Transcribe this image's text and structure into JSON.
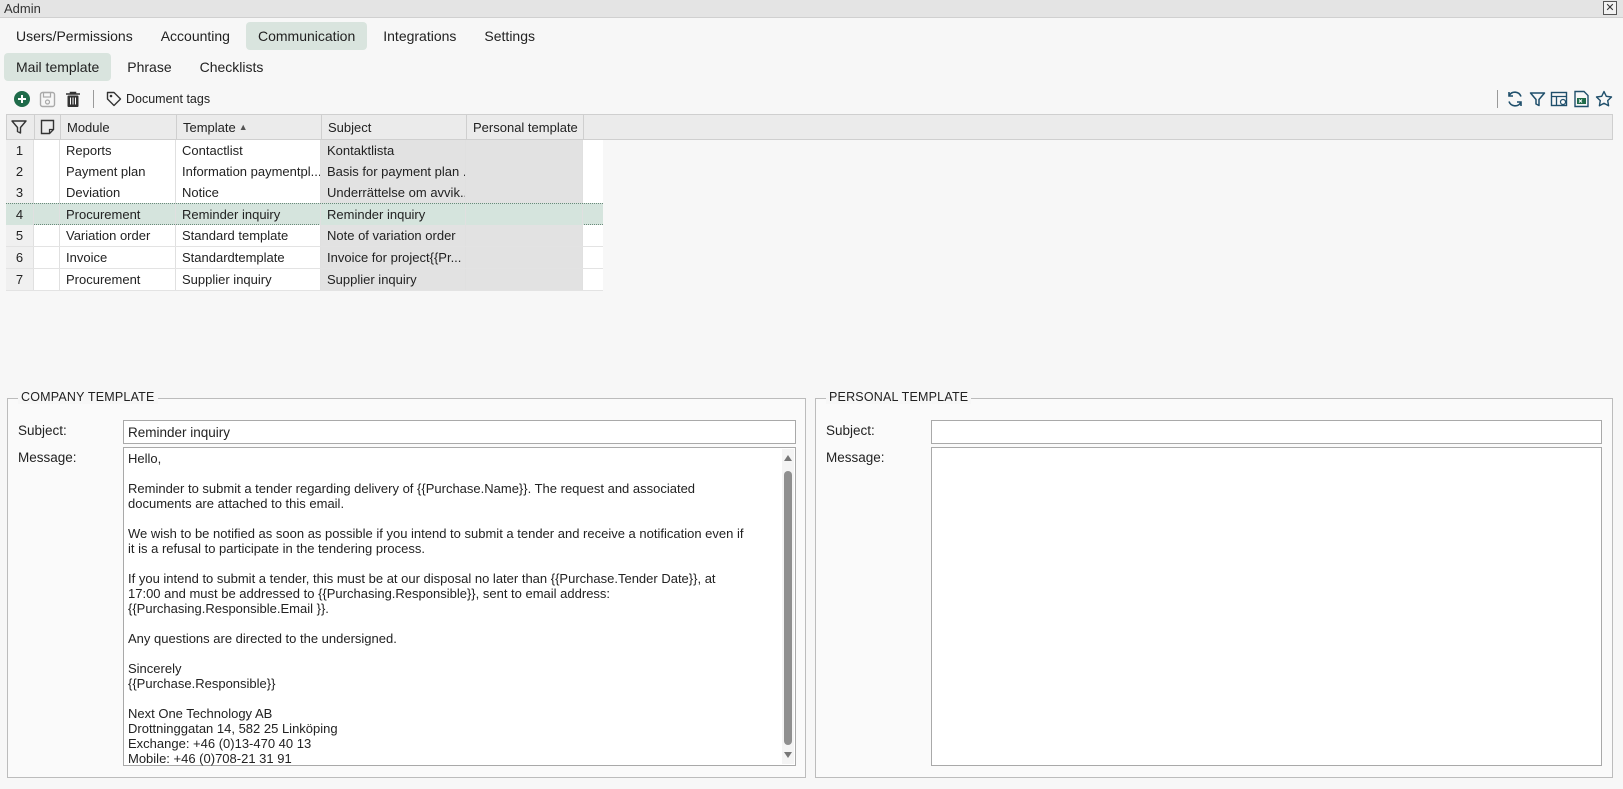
{
  "window": {
    "title": "Admin",
    "close_glyph": "✕"
  },
  "main_tabs": [
    {
      "label": "Users/Permissions"
    },
    {
      "label": "Accounting"
    },
    {
      "label": "Communication",
      "active": true
    },
    {
      "label": "Integrations"
    },
    {
      "label": "Settings"
    }
  ],
  "sub_tabs": [
    {
      "label": "Mail template",
      "active": true
    },
    {
      "label": "Phrase"
    },
    {
      "label": "Checklists"
    }
  ],
  "toolbar": {
    "add_icon": "plus-circle-icon",
    "save_icon": "save-icon",
    "delete_icon": "trash-icon",
    "document_tags_label": "Document tags",
    "right_icons": [
      "refresh-icon",
      "filter-icon",
      "table-icon",
      "excel-export-icon",
      "star-icon"
    ]
  },
  "grid": {
    "columns": [
      "Module",
      "Template",
      "Subject",
      "Personal template"
    ],
    "sort_column": "Template",
    "sort_glyph": "▲",
    "rows": [
      {
        "num": "1",
        "module": "Reports",
        "template": "Contactlist",
        "subject": "Kontaktlista",
        "personal": ""
      },
      {
        "num": "2",
        "module": "Payment plan",
        "template": "Information paymentpl...",
        "subject": "Basis for payment plan ...",
        "personal": ""
      },
      {
        "num": "3",
        "module": "Deviation",
        "template": "Notice",
        "subject": "Underrättelse om avvik...",
        "personal": ""
      },
      {
        "num": "4",
        "module": "Procurement",
        "template": "Reminder inquiry",
        "subject": "Reminder inquiry",
        "personal": "",
        "selected": true
      },
      {
        "num": "5",
        "module": "Variation order",
        "template": "Standard template",
        "subject": "Note of variation order",
        "personal": ""
      },
      {
        "num": "6",
        "module": "Invoice",
        "template": "Standardtemplate",
        "subject": "Invoice for project{{Pr...",
        "personal": ""
      },
      {
        "num": "7",
        "module": "Procurement",
        "template": "Supplier inquiry",
        "subject": "Supplier inquiry",
        "personal": ""
      }
    ]
  },
  "company_template": {
    "legend": "COMPANY TEMPLATE",
    "subject_label": "Subject:",
    "subject_value": "Reminder inquiry",
    "message_label": "Message:",
    "message_value": "Hello,\n\nReminder to submit a tender regarding delivery of {{Purchase.Name}}. The request and associated\ndocuments are attached to this email.\n\nWe wish to be notified as soon as possible if you intend to submit a tender and receive a notification even if\nit is a refusal to participate in the tendering process.\n\nIf you intend to submit a tender, this must be at our disposal no later than {{Purchase.Tender Date}}, at\n17:00 and must be addressed to {{Purchasing.Responsible}}, sent to email address:\n{{Purchasing.Responsible.Email }}.\n\nAny questions are directed to the undersigned.\n\nSincerely\n{{Purchase.Responsible}}\n\nNext One Technology AB\nDrottninggatan 14, 582 25 Linköping\nExchange: +46 (0)13-470 40 13\nMobile: +46 (0)708-21 31 91"
  },
  "personal_template": {
    "legend": "PERSONAL TEMPLATE",
    "subject_label": "Subject:",
    "subject_value": "",
    "message_label": "Message:",
    "message_value": ""
  },
  "colors": {
    "accent_green": "#1f6b4a",
    "active_tab_bg": "#d9e4de",
    "selected_row_bg": "#d5e4dd"
  }
}
